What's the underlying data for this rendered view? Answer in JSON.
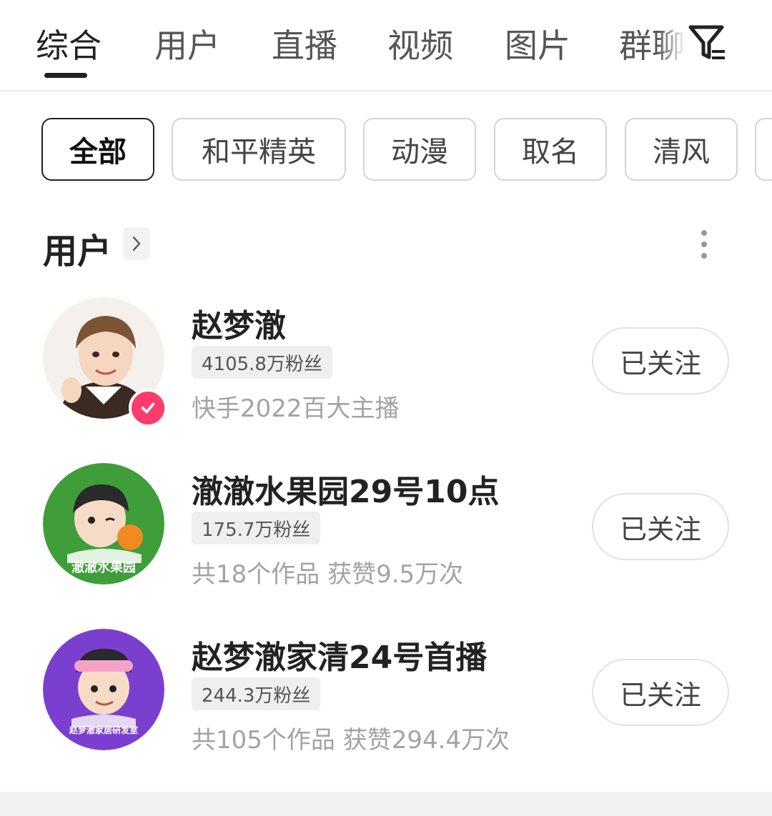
{
  "tabs": [
    {
      "label": "综合",
      "active": true
    },
    {
      "label": "用户",
      "active": false
    },
    {
      "label": "直播",
      "active": false
    },
    {
      "label": "视频",
      "active": false
    },
    {
      "label": "图片",
      "active": false
    },
    {
      "label": "群聊",
      "active": false
    }
  ],
  "filter_icon": "filter-icon",
  "chips": [
    {
      "label": "全部",
      "active": true
    },
    {
      "label": "和平精英",
      "active": false
    },
    {
      "label": "动漫",
      "active": false
    },
    {
      "label": "取名",
      "active": false
    },
    {
      "label": "清风",
      "active": false
    }
  ],
  "section": {
    "title": "用户",
    "chevron_icon": "chevron-right-icon",
    "more_icon": "more-vertical-icon"
  },
  "users": [
    {
      "name": "赵梦澈",
      "fans": "4105.8万粉丝",
      "desc": "快手2022百大主播",
      "follow_label": "已关注",
      "verified": true,
      "avatar_bg": "#f4f0ec",
      "avatar_caption": ""
    },
    {
      "name": "澈澈水果园29号10点",
      "fans": "175.7万粉丝",
      "desc": "共18个作品 获赞9.5万次",
      "follow_label": "已关注",
      "verified": false,
      "avatar_bg": "#3f9e3a",
      "avatar_caption": "澈澈水果园"
    },
    {
      "name": "赵梦澈家清24号首播",
      "fans": "244.3万粉丝",
      "desc": "共105个作品 获赞294.4万次",
      "follow_label": "已关注",
      "verified": false,
      "avatar_bg": "#7b3fd0",
      "avatar_caption": "赵梦澈家居研发室"
    }
  ],
  "colors": {
    "accent": "#ff3b6b",
    "text": "#222222",
    "muted": "#a3a3a3"
  }
}
